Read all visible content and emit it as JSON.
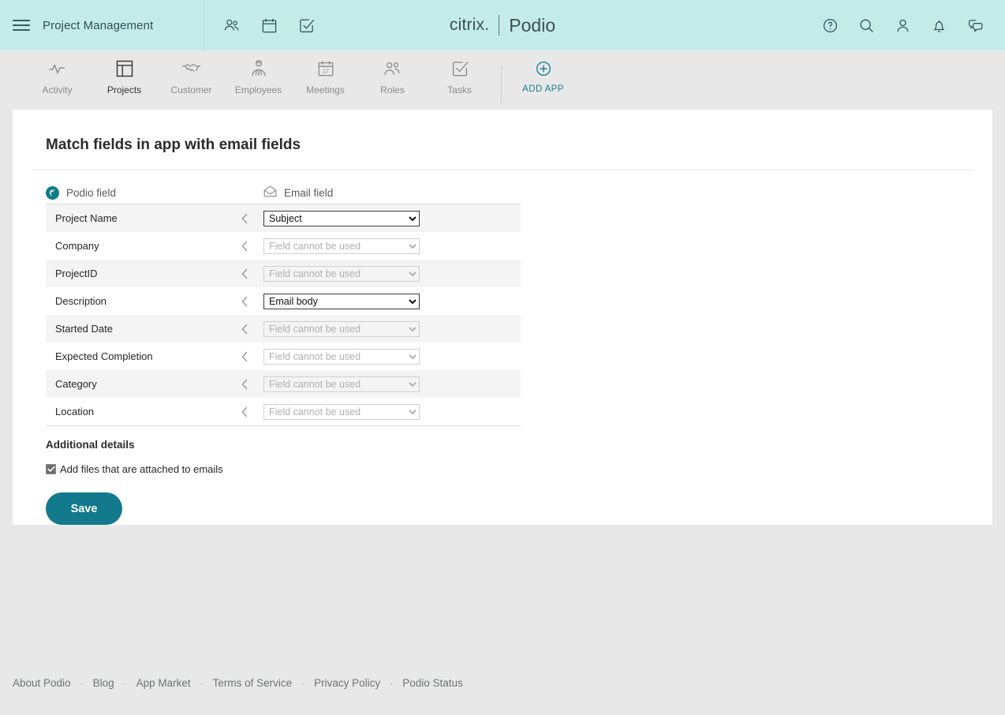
{
  "header": {
    "menu_icon": "hamburger-icon",
    "app_title": "Project Management",
    "left_icons": [
      {
        "name": "contacts-icon"
      },
      {
        "name": "calendar-icon"
      },
      {
        "name": "tasks-check-icon"
      }
    ],
    "brand": {
      "citrix": "citrix.",
      "podio": "Podio"
    },
    "right_icons": [
      {
        "name": "help-icon"
      },
      {
        "name": "search-icon"
      },
      {
        "name": "profile-icon"
      },
      {
        "name": "notifications-bell-icon"
      },
      {
        "name": "chat-icon"
      }
    ]
  },
  "appnav": {
    "items": [
      {
        "label": "Activity",
        "icon": "activity-pulse-icon",
        "active": false
      },
      {
        "label": "Projects",
        "icon": "projects-layout-icon",
        "active": true
      },
      {
        "label": "Customer",
        "icon": "handshake-icon",
        "active": false
      },
      {
        "label": "Employees",
        "icon": "employee-icon",
        "active": false
      },
      {
        "label": "Meetings",
        "icon": "calendar-17-icon",
        "active": false
      },
      {
        "label": "Roles",
        "icon": "roles-people-icon",
        "active": false
      },
      {
        "label": "Tasks",
        "icon": "task-check-icon",
        "active": false
      }
    ],
    "add_app": {
      "label": "ADD APP",
      "icon": "plus-circle-icon"
    }
  },
  "main": {
    "title": "Match fields in app with email fields",
    "columns": {
      "podio_field": "Podio field",
      "email_field": "Email field",
      "podio_icon": "podio-logo-icon",
      "email_icon": "envelope-open-icon"
    },
    "rows": [
      {
        "field": "Project Name",
        "value": "Subject",
        "enabled": true
      },
      {
        "field": "Company",
        "value": "Field cannot be used",
        "enabled": false
      },
      {
        "field": "ProjectID",
        "value": "Field cannot be used",
        "enabled": false
      },
      {
        "field": "Description",
        "value": "Email body",
        "enabled": true
      },
      {
        "field": "Started Date",
        "value": "Field cannot be used",
        "enabled": false
      },
      {
        "field": "Expected Completion",
        "value": "Field cannot be used",
        "enabled": false
      },
      {
        "field": "Category",
        "value": "Field cannot be used",
        "enabled": false
      },
      {
        "field": "Location",
        "value": "Field cannot be used",
        "enabled": false
      }
    ],
    "additional": {
      "title": "Additional details",
      "checkbox_label": "Add files that are attached to emails",
      "checkbox_checked": true
    },
    "save_label": "Save"
  },
  "footer": {
    "links": [
      "About Podio",
      "Blog",
      "App Market",
      "Terms of Service",
      "Privacy Policy",
      "Podio Status"
    ],
    "separator": "·"
  },
  "colors": {
    "header_bg": "#c3ece9",
    "page_bg": "#e8e8e8",
    "accent": "#13798c",
    "row_alt": "#f4f4f4"
  }
}
